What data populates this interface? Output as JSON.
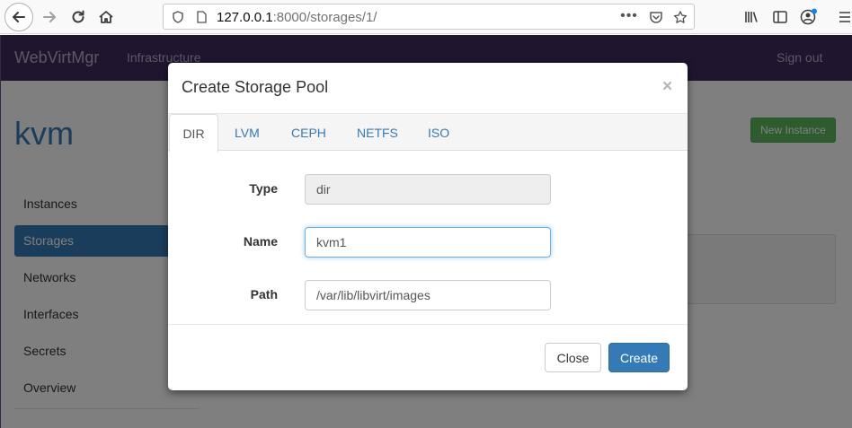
{
  "browser": {
    "url_host": "127.0.0.1",
    "url_path": ":8000/storages/1/"
  },
  "navbar": {
    "brand": "WebVirtMgr",
    "link_infrastructure": "Infrastructure",
    "signout": "Sign out"
  },
  "page": {
    "host_title": "kvm",
    "new_instance": "New Instance"
  },
  "sidebar": {
    "items": [
      {
        "label": "Instances"
      },
      {
        "label": "Storages"
      },
      {
        "label": "Networks"
      },
      {
        "label": "Interfaces"
      },
      {
        "label": "Secrets"
      },
      {
        "label": "Overview"
      }
    ],
    "active": "Storages"
  },
  "modal": {
    "title": "Create Storage Pool",
    "close_symbol": "×",
    "tabs": [
      {
        "label": "DIR"
      },
      {
        "label": "LVM"
      },
      {
        "label": "CEPH"
      },
      {
        "label": "NETFS"
      },
      {
        "label": "ISO"
      }
    ],
    "active_tab": "DIR",
    "form": {
      "type_label": "Type",
      "type_value": "dir",
      "name_label": "Name",
      "name_value": "kvm1",
      "path_label": "Path",
      "path_value": "/var/lib/libvirt/images"
    },
    "close_button": "Close",
    "create_button": "Create"
  },
  "colors": {
    "navbar_bg": "#3f2a5e",
    "primary": "#337ab7",
    "success": "#5cb85c"
  }
}
